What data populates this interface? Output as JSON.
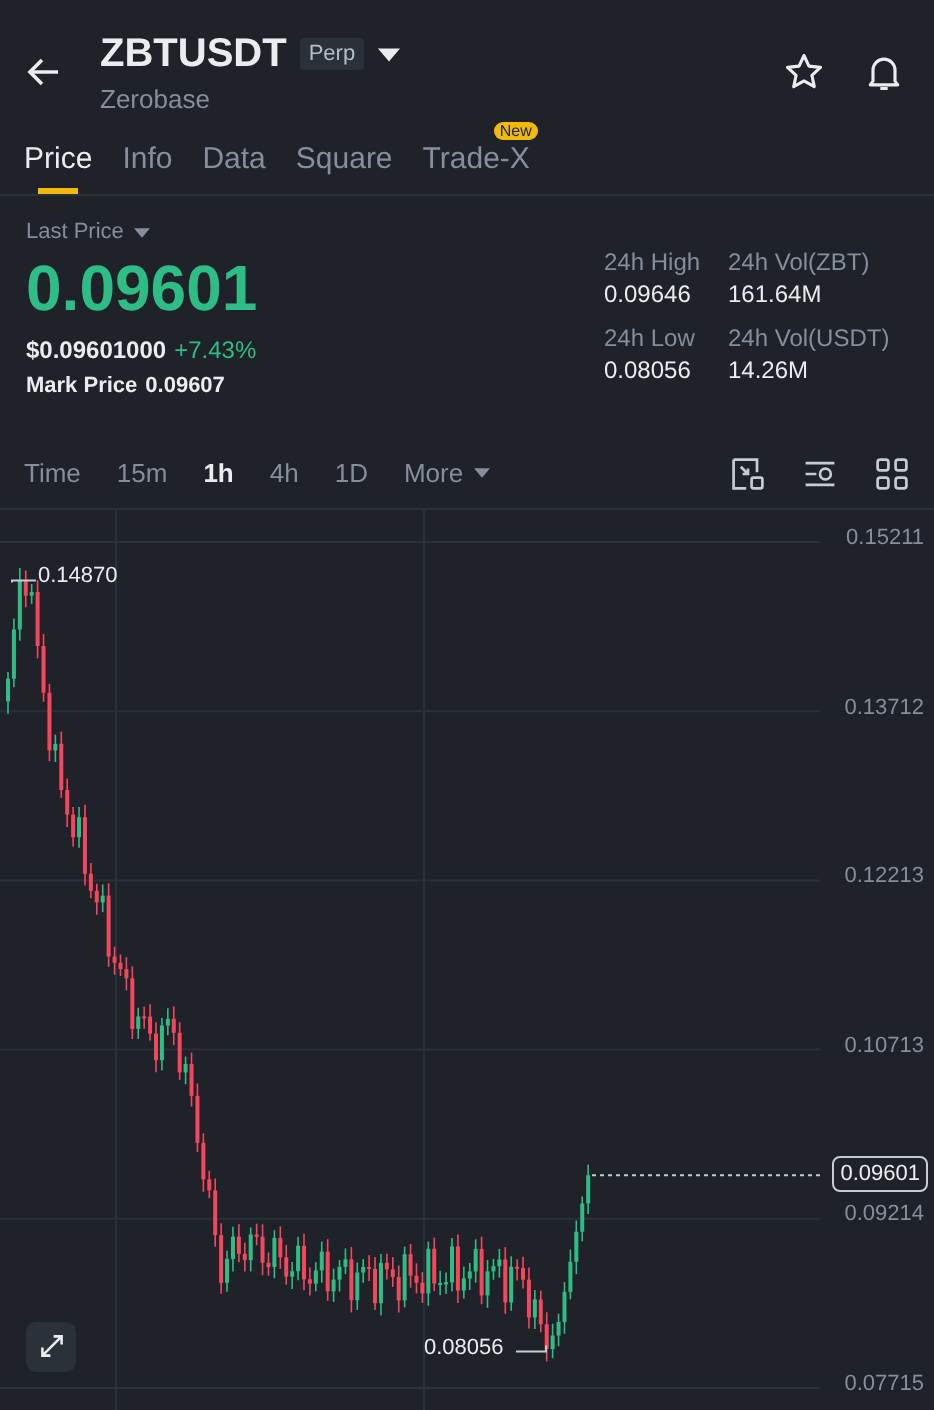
{
  "header": {
    "symbol": "ZBTUSDT",
    "badge": "Perp",
    "subtitle": "Zerobase"
  },
  "tabs": [
    {
      "label": "Price",
      "selected": true
    },
    {
      "label": "Info",
      "selected": false
    },
    {
      "label": "Data",
      "selected": false
    },
    {
      "label": "Square",
      "selected": false
    },
    {
      "label": "Trade-X",
      "selected": false,
      "badge": "New"
    }
  ],
  "price": {
    "label": "Last Price",
    "value": "0.09601",
    "usd": "$0.09601000",
    "change": "+7.43%",
    "mark_label": "Mark Price",
    "mark_value": "0.09607"
  },
  "stats": [
    {
      "label": "24h High",
      "value": "0.09646"
    },
    {
      "label": "24h Vol(ZBT)",
      "value": "161.64M"
    },
    {
      "label": "24h Low",
      "value": "0.08056"
    },
    {
      "label": "24h Vol(USDT)",
      "value": "14.26M"
    }
  ],
  "intervals": [
    {
      "label": "Time",
      "selected": false,
      "kind": "plain"
    },
    {
      "label": "15m",
      "selected": false,
      "kind": "plain"
    },
    {
      "label": "1h",
      "selected": true,
      "kind": "plain"
    },
    {
      "label": "4h",
      "selected": false,
      "kind": "plain"
    },
    {
      "label": "1D",
      "selected": false,
      "kind": "plain"
    },
    {
      "label": "More",
      "selected": false,
      "kind": "menu"
    }
  ],
  "chart": {
    "y_labels": [
      "0.15211",
      "0.13712",
      "0.12213",
      "0.10713",
      "0.09214",
      "0.07715"
    ],
    "high_marker": "0.14870",
    "low_marker": "0.08056",
    "last_price": "0.09601"
  }
}
